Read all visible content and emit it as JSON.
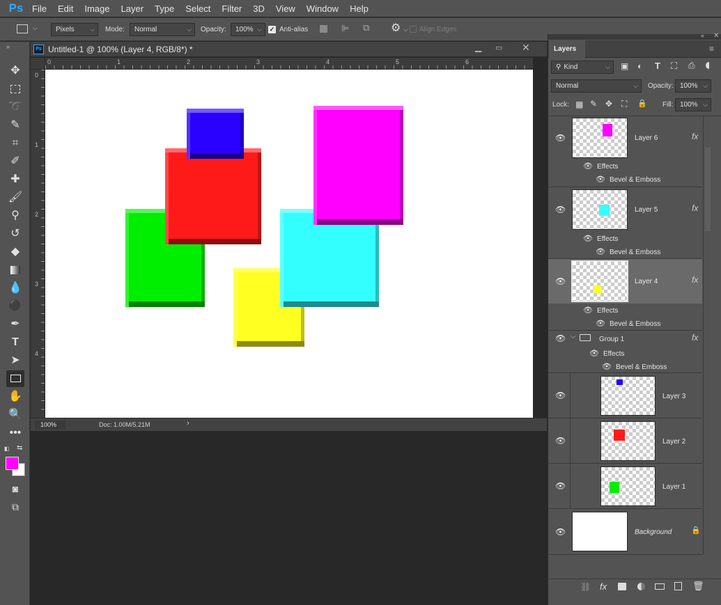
{
  "app": {
    "logo": "Ps"
  },
  "menu": [
    "File",
    "Edit",
    "Image",
    "Layer",
    "Type",
    "Select",
    "Filter",
    "3D",
    "View",
    "Window",
    "Help"
  ],
  "options": {
    "units": "Pixels",
    "mode_label": "Mode:",
    "mode_value": "Normal",
    "opacity_label": "Opacity:",
    "opacity_value": "100%",
    "antialias_label": "Anti-alias",
    "align_edges_label": "Align Edges"
  },
  "document": {
    "tab_title": "Untitled-1 @ 100% (Layer 4, RGB/8*) *",
    "tab_icon": "Ps",
    "ruler_h": [
      "0",
      "1",
      "2",
      "3",
      "4",
      "5",
      "6"
    ],
    "ruler_v": [
      "0",
      "1",
      "2",
      "3",
      "4"
    ],
    "zoom": "100%",
    "doc_info": "Doc: 1.00M/5.21M",
    "shapes_colors": {
      "green": "#00ee00",
      "red": "#ff1a1a",
      "blue": "#2a00ff",
      "yellow": "#ffff22",
      "cyan": "#33ffff",
      "magenta": "#ff00ff"
    }
  },
  "colors": {
    "foreground": "#ff00ff",
    "background": "#ffffff"
  },
  "layers_panel": {
    "title": "Layers",
    "filter_kind": "Kind",
    "blend_mode": "Normal",
    "opacity_label": "Opacity:",
    "opacity_value": "100%",
    "lock_label": "Lock:",
    "fill_label": "Fill:",
    "fill_value": "100%",
    "effects_label": "Effects",
    "bevel_label": "Bevel & Emboss",
    "layers": [
      {
        "name": "Layer 6",
        "color": "#ff00ff",
        "fx": "fx"
      },
      {
        "name": "Layer 5",
        "color": "#33ffff",
        "fx": "fx"
      },
      {
        "name": "Layer 4",
        "color": "#ffff22",
        "fx": "fx",
        "selected": true
      },
      {
        "name": "Group 1",
        "fx": "fx"
      },
      {
        "name": "Layer 3",
        "color": "#2a00ff"
      },
      {
        "name": "Layer 2",
        "color": "#ff1a1a"
      },
      {
        "name": "Layer 1",
        "color": "#00ee00"
      },
      {
        "name": "Background"
      }
    ]
  }
}
